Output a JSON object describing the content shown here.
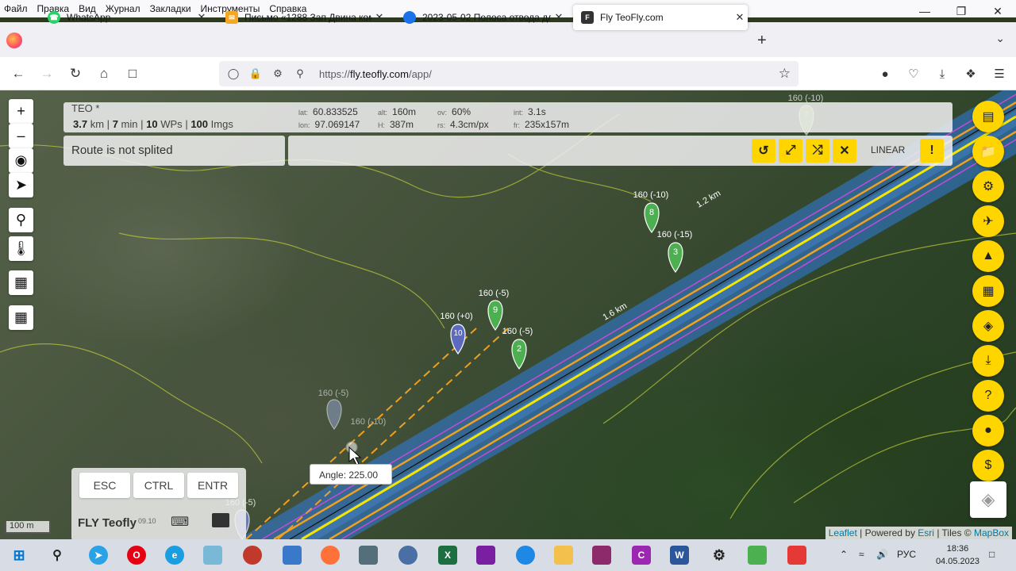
{
  "menu": [
    "Файл",
    "Правка",
    "Вид",
    "Журнал",
    "Закладки",
    "Инструменты",
    "Справка"
  ],
  "tabs": [
    {
      "title": "WhatsApp",
      "color": "#25d366"
    },
    {
      "title": "Письмо «1288 Зап Двина комі",
      "color": "#f5a623"
    },
    {
      "title": "2023-05-02 Полоса отвода для",
      "color": "#1a73e8"
    },
    {
      "title": "Fly TeoFly.com",
      "color": "#333333"
    }
  ],
  "url": {
    "prefix": "https://",
    "host": "fly.teofly.com",
    "path": "/app/"
  },
  "info": {
    "name": "TEO *",
    "km": "3.7",
    "km_unit": "km",
    "min": "7",
    "min_unit": "min",
    "wps": "10",
    "wps_unit": "WPs",
    "imgs": "100",
    "imgs_unit": "Imgs",
    "lat_label": "lat:",
    "lat": "60.833525",
    "lon_label": "lon:",
    "lon": "97.069147",
    "alt_label": "alt:",
    "alt": "160m",
    "h_label": "H:",
    "h": "387m",
    "ov_label": "ov:",
    "ov": "60%",
    "rs_label": "rs:",
    "rs": "4.3cm/px",
    "int_label": "int:",
    "int": "3.1s",
    "fr_label": "fr:",
    "fr": "235x157m"
  },
  "route_status": "Route is not splited",
  "mode": "LINEAR",
  "sep": "|",
  "waypoints": [
    {
      "n": "8",
      "label": "160 (-10)",
      "color": "#4caf50"
    },
    {
      "n": "3",
      "label": "160 (-15)",
      "color": "#4caf50"
    },
    {
      "n": "9",
      "label": "160 (-5)",
      "color": "#4caf50"
    },
    {
      "n": "2",
      "label": "160 (-5)",
      "color": "#4caf50"
    },
    {
      "n": "10",
      "label": "160 (+0)",
      "color": "#5c6bc0"
    },
    {
      "n": "7",
      "label": "160 (-10)",
      "color": "#8bc34a"
    },
    {
      "n": "",
      "label": "160 (-5)",
      "color": "#8fa0c8"
    },
    {
      "n": "",
      "label": "160 (-10)",
      "color": "#8fa0c8"
    },
    {
      "n": "",
      "label": "160 (-5)",
      "color": "#7986cb"
    }
  ],
  "dist_labels": [
    "1.2 km",
    "1.6 km"
  ],
  "tooltip": "Angle: 225.00",
  "keys": [
    "ESC",
    "CTRL",
    "ENTR"
  ],
  "brand": "FLY Teofly",
  "brand_version": "09.10",
  "scale": "100 m",
  "attribution": {
    "leaflet": "Leaflet",
    "powered": "| Powered by",
    "esri": "Esri",
    "tiles": "| Tiles ©",
    "mapbox": "MapBox"
  },
  "tray": {
    "lang": "РУС",
    "time": "18:36",
    "date": "04.05.2023"
  }
}
